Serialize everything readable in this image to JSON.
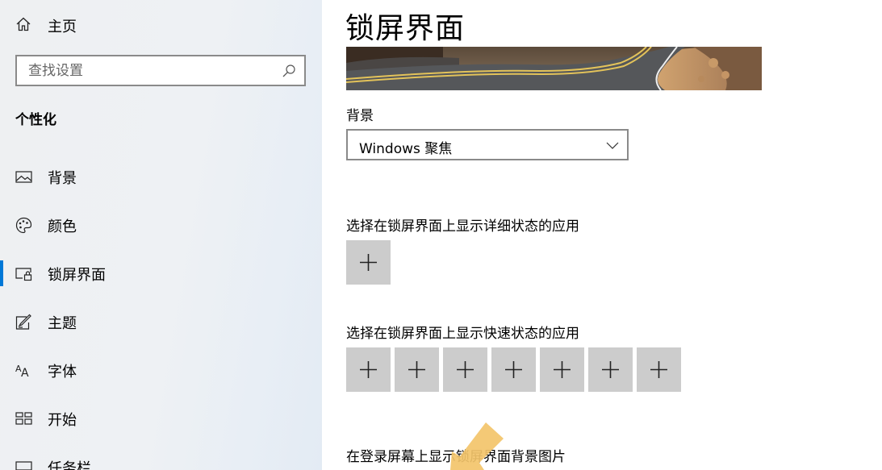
{
  "sidebar": {
    "home_label": "主页",
    "search_placeholder": "查找设置",
    "section_title": "个性化",
    "active_accent_color": "#0078d7",
    "items": [
      {
        "label": "背景",
        "icon": "picture-icon"
      },
      {
        "label": "颜色",
        "icon": "palette-icon"
      },
      {
        "label": "锁屏界面",
        "icon": "lock-screen-icon",
        "active": true
      },
      {
        "label": "主题",
        "icon": "theme-icon"
      },
      {
        "label": "字体",
        "icon": "font-icon"
      },
      {
        "label": "开始",
        "icon": "start-icon"
      },
      {
        "label": "任务栏",
        "icon": "taskbar-icon"
      }
    ]
  },
  "main": {
    "title": "锁屏界面",
    "background_label": "背景",
    "background_value": "Windows 聚焦",
    "detailed_status_label": "选择在锁屏界面上显示详细状态的应用",
    "quick_status_label": "选择在锁屏界面上显示快速状态的应用",
    "signin_background_label": "在登录屏幕上显示锁屏界面背景图片",
    "tile_color": "#cccccc"
  }
}
